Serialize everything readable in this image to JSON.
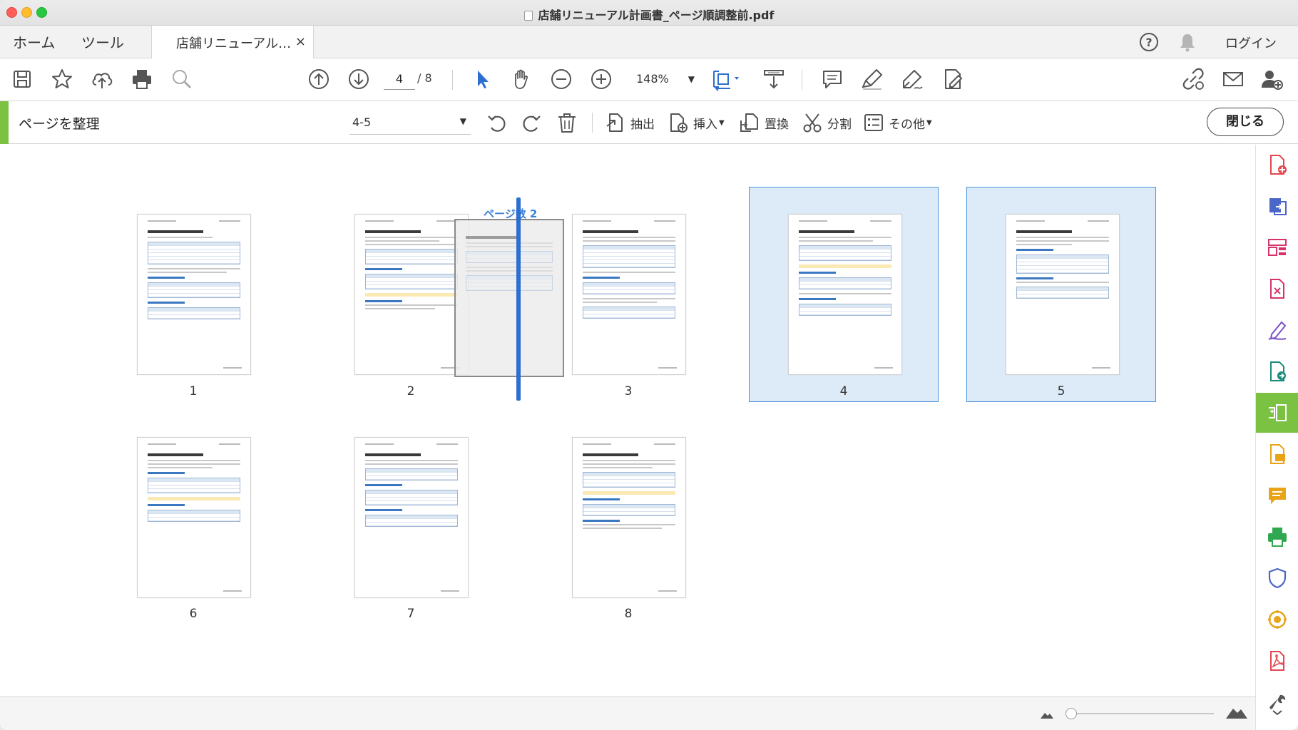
{
  "window": {
    "title": "店舗リニューアル計画書_ページ順調整前.pdf"
  },
  "tabs": {
    "home": "ホーム",
    "tools": "ツール",
    "document": "店舗リニューアル…",
    "close_glyph": "×",
    "login": "ログイン"
  },
  "toolbar": {
    "current_page": "4",
    "total_pages": "/ 8",
    "zoom": "148%"
  },
  "organize": {
    "title": "ページを整理",
    "range": "4-5",
    "extract": "抽出",
    "insert": "挿入",
    "replace": "置換",
    "split": "分割",
    "more": "その他",
    "close": "閉じる"
  },
  "drag": {
    "label": "ページ数 2"
  },
  "pages": [
    {
      "num": "1",
      "selected": false
    },
    {
      "num": "2",
      "selected": false
    },
    {
      "num": "3",
      "selected": false
    },
    {
      "num": "4",
      "selected": true
    },
    {
      "num": "5",
      "selected": true
    },
    {
      "num": "6",
      "selected": false
    },
    {
      "num": "7",
      "selected": false
    },
    {
      "num": "8",
      "selected": false
    }
  ],
  "colors": {
    "accent_green": "#7cc242",
    "selection_blue": "#4a90d9",
    "selection_fill": "#ddebf8",
    "drop_indicator": "#2d6fd0"
  },
  "rail_icons": [
    "create-pdf-icon",
    "export-pdf-icon",
    "organize-layout-icon",
    "edit-pdf-icon",
    "fill-sign-icon",
    "send-for-review-icon",
    "organize-pages-icon",
    "comment-file-icon",
    "comment-icon",
    "print-production-icon",
    "protect-icon",
    "optimize-icon",
    "acrobat-icon",
    "tools-wrench-icon"
  ]
}
